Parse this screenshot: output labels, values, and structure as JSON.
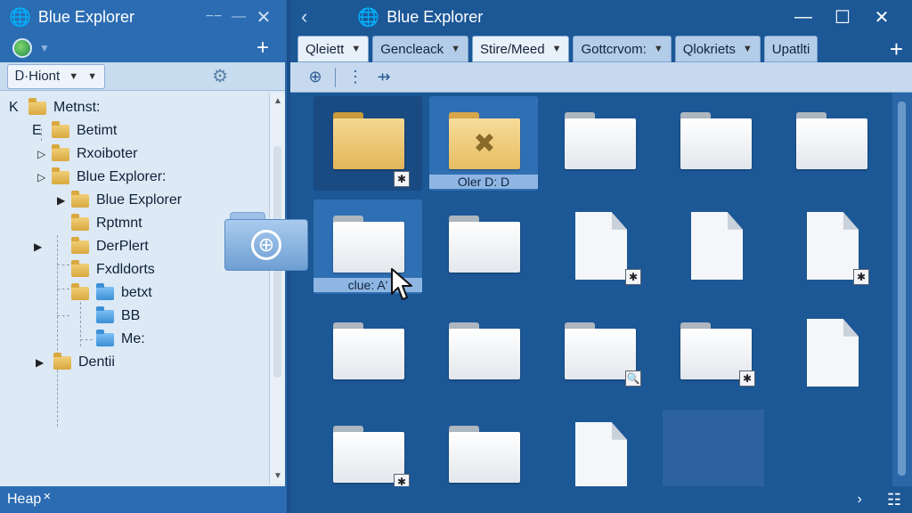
{
  "colors": {
    "accent": "#2c6cb3",
    "background": "#1b4f8c",
    "tree_bg": "#dde9f5"
  },
  "left": {
    "title": "Blue Explorer",
    "title_icon": "globe-icon",
    "dropdown_label": "Ꭰ·Hiont",
    "tree": [
      {
        "label": "Metnst:",
        "prefix": "K"
      },
      {
        "label": "Betimt",
        "prefix": "E"
      },
      {
        "label": "Rxoibοter"
      },
      {
        "label": "Blue Explorer:"
      },
      {
        "label": "Blue Explorer"
      },
      {
        "label": "Rptmnt"
      },
      {
        "label": "DerPlert"
      },
      {
        "label": "Fxdldorts"
      },
      {
        "label": "betxt"
      },
      {
        "label": "BB"
      },
      {
        "label": "Me:"
      },
      {
        "label": "Dentii"
      }
    ],
    "status": "Heap"
  },
  "right": {
    "title": "Blue Explorer",
    "tabs": [
      "Qleiett",
      "Gencleack",
      "Stire/Meed",
      "Gottcrvom:",
      "Qlokriets",
      "Upatlti"
    ],
    "grid": [
      {
        "label": ""
      },
      {
        "label": "Oler D: D"
      },
      {
        "label": ""
      },
      {
        "label": ""
      },
      {
        "label": ""
      },
      {
        "label": "clue: A'"
      },
      {
        "label": ""
      },
      {
        "label": ""
      },
      {
        "label": ""
      },
      {
        "label": ""
      },
      {
        "label": ""
      },
      {
        "label": ""
      },
      {
        "label": ""
      },
      {
        "label": ""
      },
      {
        "label": ""
      },
      {
        "label": ""
      },
      {
        "label": ""
      }
    ]
  }
}
